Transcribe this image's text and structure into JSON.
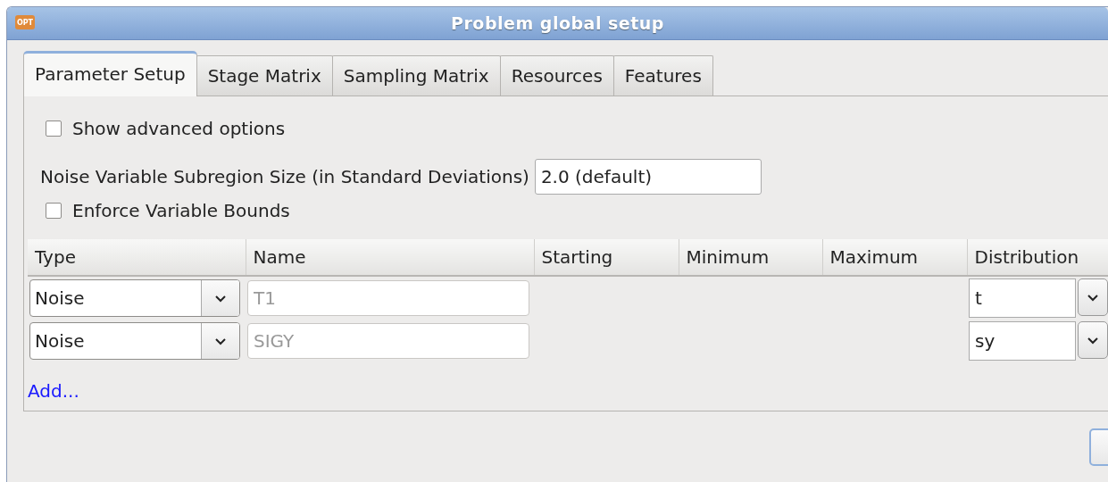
{
  "window": {
    "title": "Problem global setup",
    "icon_text": "OPT"
  },
  "tabs": [
    {
      "label": "Parameter Setup",
      "selected": true
    },
    {
      "label": "Stage Matrix",
      "selected": false
    },
    {
      "label": "Sampling Matrix",
      "selected": false
    },
    {
      "label": "Resources",
      "selected": false
    },
    {
      "label": "Features",
      "selected": false
    }
  ],
  "show_advanced": {
    "label": "Show advanced options",
    "checked": false
  },
  "subregion": {
    "label": "Noise Variable Subregion Size (in Standard Deviations)",
    "value": "2.0 (default)"
  },
  "enforce_bounds": {
    "label": "Enforce Variable Bounds",
    "checked": false
  },
  "table": {
    "columns": [
      "Type",
      "Name",
      "Starting",
      "Minimum",
      "Maximum",
      "Distribution"
    ],
    "rows": [
      {
        "type": "Noise",
        "name_placeholder": "T1",
        "distribution": "t"
      },
      {
        "type": "Noise",
        "name_placeholder": "SIGY",
        "distribution": "sy"
      }
    ]
  },
  "add_link": "Add..."
}
